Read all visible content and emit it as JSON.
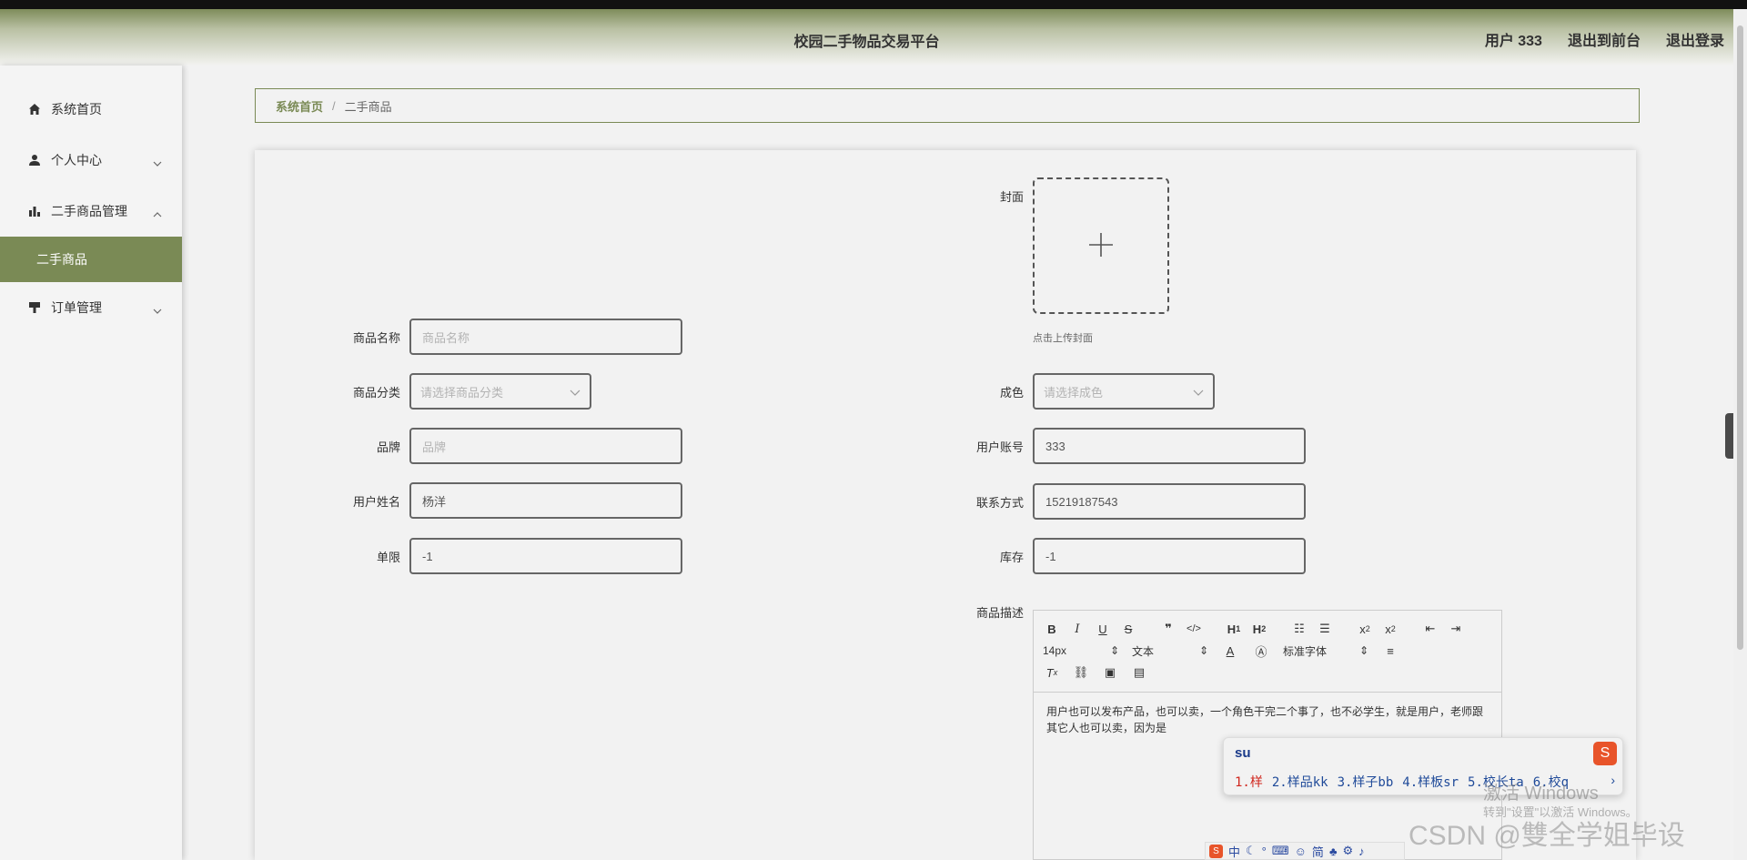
{
  "header": {
    "title": "校园二手物品交易平台",
    "user": "用户 333",
    "to_front": "退出到前台",
    "logout": "退出登录"
  },
  "sidebar": {
    "items": [
      {
        "label": "系统首页",
        "icon": "home-icon"
      },
      {
        "label": "个人中心",
        "icon": "user-icon"
      },
      {
        "label": "二手商品管理",
        "icon": "bar-chart-icon"
      },
      {
        "label": "订单管理",
        "icon": "order-icon"
      }
    ],
    "active_sub": "二手商品"
  },
  "breadcrumb": {
    "home": "系统首页",
    "sep": "/",
    "current": "二手商品"
  },
  "form": {
    "cover": {
      "label": "封面",
      "hint": "点击上传封面"
    },
    "name": {
      "label": "商品名称",
      "placeholder": "商品名称"
    },
    "category": {
      "label": "商品分类",
      "placeholder": "请选择商品分类"
    },
    "condition": {
      "label": "成色",
      "placeholder": "请选择成色"
    },
    "brand": {
      "label": "品牌",
      "placeholder": "品牌"
    },
    "account": {
      "label": "用户账号",
      "value": "333"
    },
    "username": {
      "label": "用户姓名",
      "value": "杨洋"
    },
    "contact": {
      "label": "联系方式",
      "value": "15219187543"
    },
    "limit": {
      "label": "单限",
      "value": "-1"
    },
    "stock": {
      "label": "库存",
      "value": "-1"
    },
    "description": {
      "label": "商品描述",
      "text": "用户也可以发布产品，也可以卖，一个角色干完二个事了，也不必学生，就是用户，老师跟其它人也可以卖，因为是"
    }
  },
  "editor": {
    "font_size": "14px",
    "block_type": "文本",
    "font_family": "标准字体"
  },
  "ime": {
    "typed": "su",
    "candidates": [
      "1.样",
      "2.样品kk",
      "3.样子bb",
      "4.样板sr",
      "5.校长ta",
      "6.校q"
    ],
    "bar_mode": "中",
    "bar_simplified": "简"
  },
  "watermark": {
    "windows_line1": "激活 Windows",
    "windows_line2": "转到\"设置\"以激活 Windows。",
    "csdn": "CSDN @雙全学姐毕设"
  },
  "colors": {
    "accent": "#7a8a55",
    "ime_logo": "#e8542a"
  }
}
